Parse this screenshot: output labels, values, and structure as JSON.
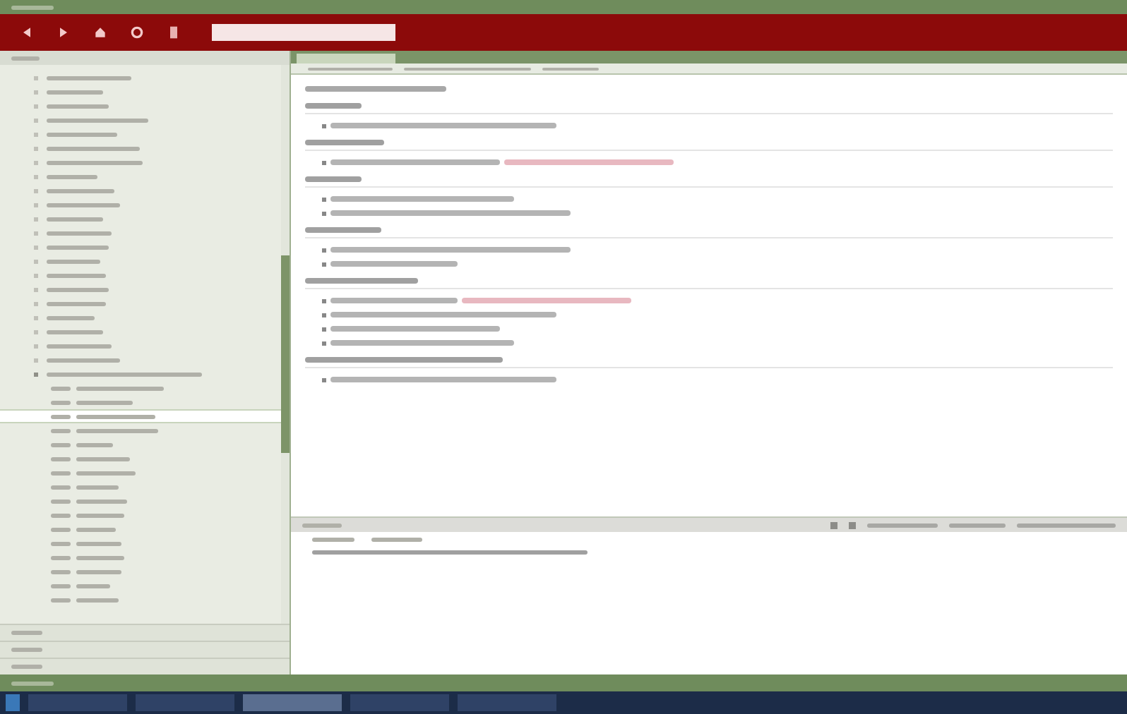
{
  "toolbar": {
    "buttons": [
      {
        "kind": "back"
      },
      {
        "kind": "forward"
      },
      {
        "kind": "home"
      },
      {
        "kind": "refresh"
      },
      {
        "kind": "page"
      }
    ]
  },
  "sidebar": {
    "tree": [
      {
        "expanded": false
      },
      {
        "expanded": false
      },
      {
        "expanded": false
      },
      {
        "expanded": false
      },
      {
        "expanded": false
      },
      {
        "expanded": false
      },
      {
        "expanded": false
      },
      {
        "expanded": false
      },
      {
        "expanded": false
      },
      {
        "expanded": false
      },
      {
        "expanded": false
      },
      {
        "expanded": false
      },
      {
        "expanded": false
      },
      {
        "expanded": false
      },
      {
        "expanded": false
      },
      {
        "expanded": false
      },
      {
        "expanded": false
      },
      {
        "expanded": false
      },
      {
        "expanded": false
      },
      {
        "expanded": false
      },
      {
        "expanded": false
      },
      {
        "expanded": true,
        "children": [
          {
            "selected": false
          },
          {
            "selected": false
          },
          {
            "selected": true
          },
          {
            "selected": false
          },
          {
            "selected": false
          },
          {
            "selected": false
          },
          {
            "selected": false
          },
          {
            "selected": false
          },
          {
            "selected": false
          },
          {
            "selected": false
          },
          {
            "selected": false
          },
          {
            "selected": false
          },
          {
            "selected": false
          },
          {
            "selected": false
          },
          {
            "selected": false
          },
          {
            "selected": false
          }
        ]
      }
    ],
    "panels": [
      {
        "expanded": false
      },
      {
        "expanded": false
      },
      {
        "expanded": false
      }
    ]
  },
  "tabs": [
    {
      "selected": true
    }
  ],
  "content": {
    "sections": [
      {
        "kind": "title"
      },
      {
        "kind": "section",
        "items": [
          {
            "kind": "plain"
          }
        ]
      },
      {
        "kind": "section",
        "items": [
          {
            "kind": "link"
          }
        ]
      },
      {
        "kind": "section",
        "items": [
          {
            "kind": "plain"
          },
          {
            "kind": "plain"
          }
        ]
      },
      {
        "kind": "section",
        "items": [
          {
            "kind": "plain"
          },
          {
            "kind": "plain"
          }
        ]
      },
      {
        "kind": "section",
        "items": [
          {
            "kind": "link"
          },
          {
            "kind": "plain"
          },
          {
            "kind": "plain"
          },
          {
            "kind": "plain"
          }
        ]
      },
      {
        "kind": "section",
        "items": [
          {
            "kind": "plain"
          }
        ]
      }
    ]
  },
  "bottom_panel": {
    "rows": [
      {
        "kind": "header"
      },
      {
        "kind": "line"
      }
    ]
  },
  "taskbar": {
    "buttons": [
      {
        "selected": false
      },
      {
        "selected": false
      },
      {
        "selected": true
      },
      {
        "selected": false
      },
      {
        "selected": false
      }
    ]
  }
}
